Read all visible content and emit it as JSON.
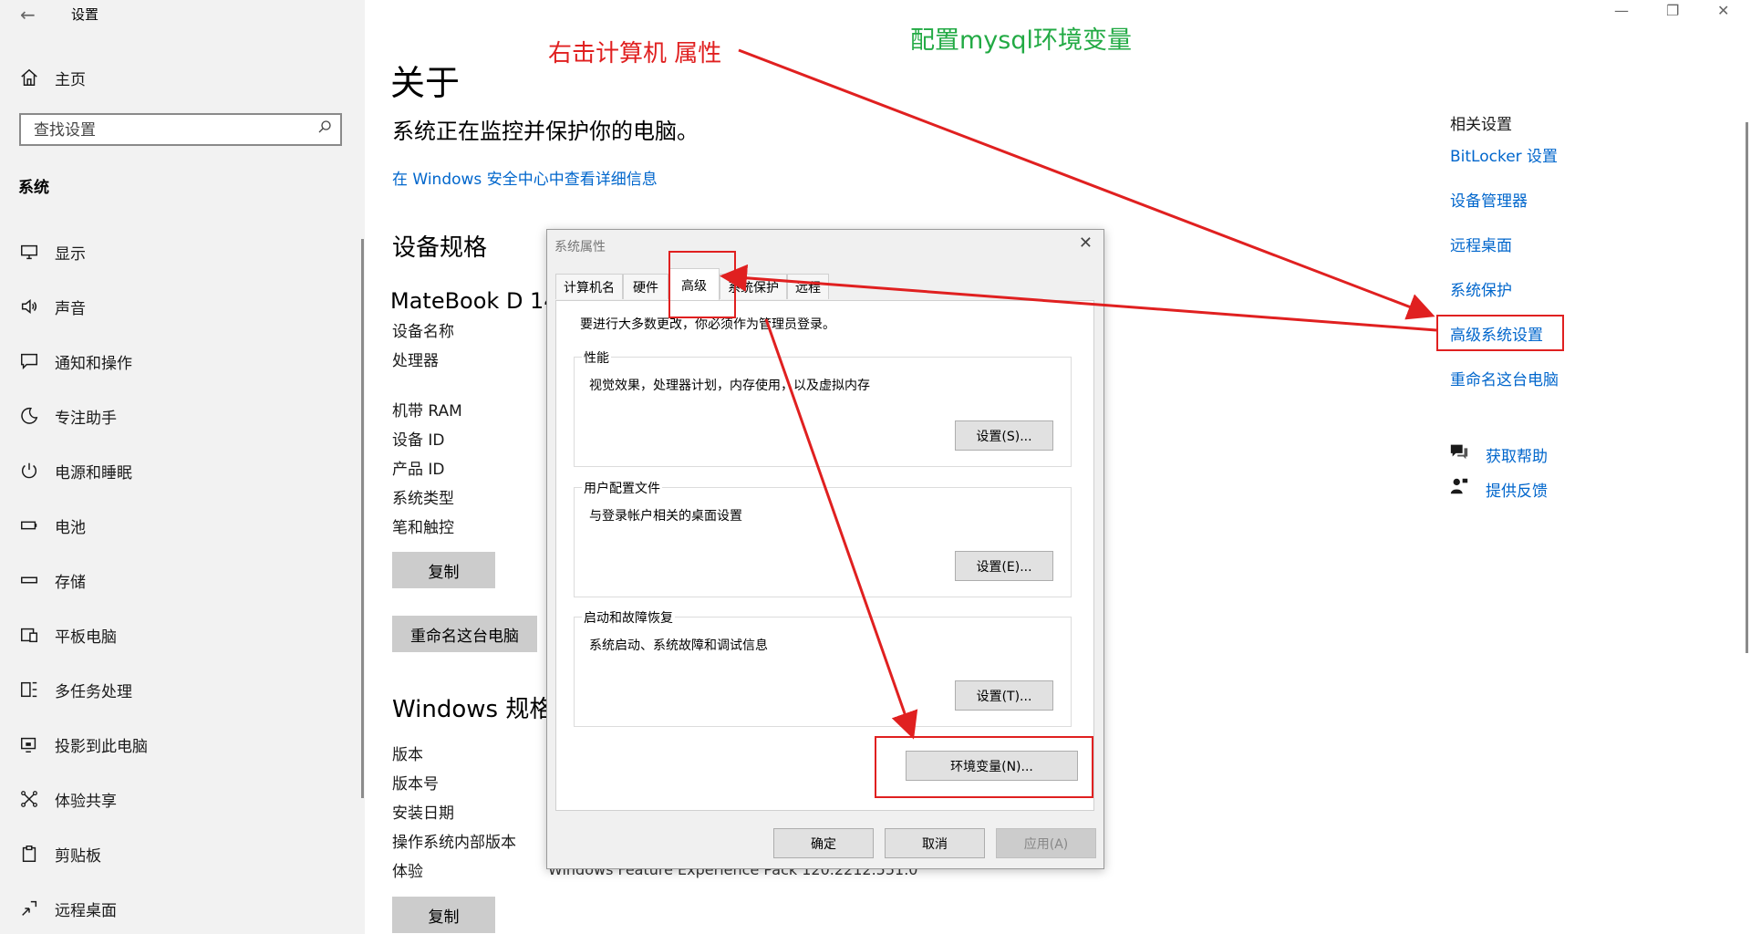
{
  "window": {
    "title": "设置",
    "controls": {
      "minimize": "—",
      "restore": "❐",
      "close": "✕"
    }
  },
  "sidebar": {
    "home": "主页",
    "search_placeholder": "查找设置",
    "section": "系统",
    "items": [
      {
        "label": "显示",
        "icon": "display-icon"
      },
      {
        "label": "声音",
        "icon": "sound-icon"
      },
      {
        "label": "通知和操作",
        "icon": "notification-icon"
      },
      {
        "label": "专注助手",
        "icon": "moon-icon"
      },
      {
        "label": "电源和睡眠",
        "icon": "power-icon"
      },
      {
        "label": "电池",
        "icon": "battery-icon"
      },
      {
        "label": "存储",
        "icon": "storage-icon"
      },
      {
        "label": "平板电脑",
        "icon": "tablet-icon"
      },
      {
        "label": "多任务处理",
        "icon": "multitask-icon"
      },
      {
        "label": "投影到此电脑",
        "icon": "projection-icon"
      },
      {
        "label": "体验共享",
        "icon": "share-icon"
      },
      {
        "label": "剪贴板",
        "icon": "clipboard-icon"
      },
      {
        "label": "远程桌面",
        "icon": "remote-icon"
      }
    ]
  },
  "main": {
    "title": "关于",
    "status": "系统正在监控并保护你的电脑。",
    "security_link": "在 Windows 安全中心中查看详细信息",
    "device_spec_heading": "设备规格",
    "device_model": "MateBook D 14",
    "device_labels": [
      "设备名称",
      "处理器",
      "机带 RAM",
      "设备 ID",
      "产品 ID",
      "系统类型",
      "笔和触控"
    ],
    "copy_button": "复制",
    "rename_button": "重命名这台电脑",
    "windows_spec_heading": "Windows 规格",
    "windows_labels": [
      "版本",
      "版本号",
      "安装日期",
      "操作系统内部版本",
      "体验"
    ],
    "experience_value": "Windows Feature Experience Pack 120.2212.551.0",
    "copy_button_2": "复制"
  },
  "related": {
    "heading": "相关设置",
    "links": [
      "BitLocker 设置",
      "设备管理器",
      "远程桌面",
      "系统保护",
      "高级系统设置",
      "重命名这台电脑"
    ],
    "help": "获取帮助",
    "feedback": "提供反馈"
  },
  "dialog": {
    "title": "系统属性",
    "close": "✕",
    "tabs": [
      "计算机名",
      "硬件",
      "高级",
      "系统保护",
      "远程"
    ],
    "admin_note": "要进行大多数更改，你必须作为管理员登录。",
    "groups": [
      {
        "title": "性能",
        "desc": "视觉效果，处理器计划，内存使用，以及虚拟内存",
        "button": "设置(S)..."
      },
      {
        "title": "用户配置文件",
        "desc": "与登录帐户相关的桌面设置",
        "button": "设置(E)..."
      },
      {
        "title": "启动和故障恢复",
        "desc": "系统启动、系统故障和调试信息",
        "button": "设置(T)..."
      }
    ],
    "env_button": "环境变量(N)...",
    "ok": "确定",
    "cancel": "取消",
    "apply": "应用(A)"
  },
  "annotations": {
    "right_click": "右击计算机 属性",
    "mysql_env": "配置mysql环境变量",
    "red": "#e02020",
    "green": "#22aa44"
  }
}
